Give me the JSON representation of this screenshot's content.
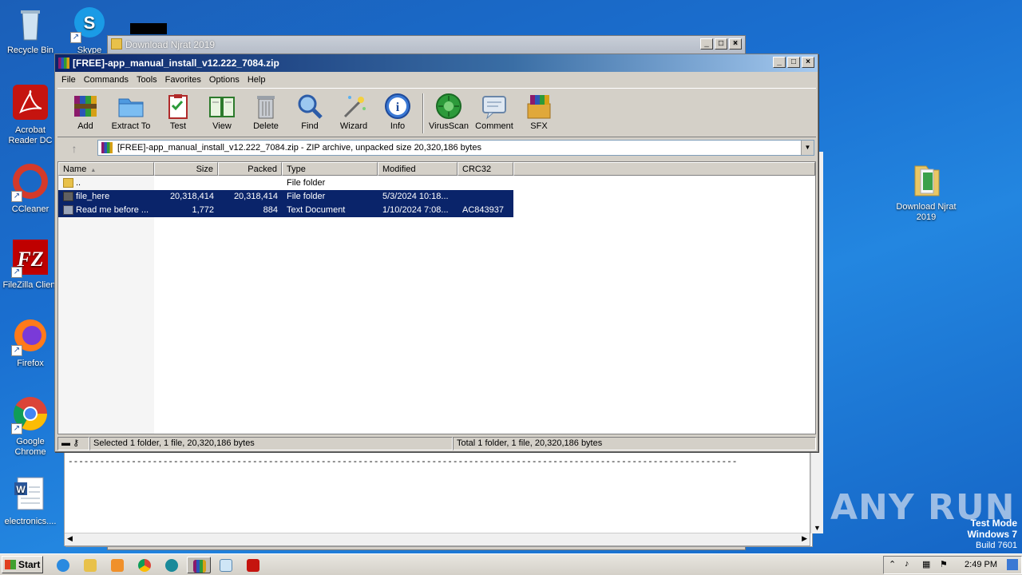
{
  "desktop": {
    "icons_left": [
      {
        "label": "Recycle Bin"
      },
      {
        "label": "Skype"
      },
      {
        "label": "Acrobat Reader DC"
      },
      {
        "label": "CCleaner"
      },
      {
        "label": "FileZilla Client"
      },
      {
        "label": "Firefox"
      },
      {
        "label": "Google Chrome"
      },
      {
        "label": "electronics...."
      }
    ],
    "icon_right": {
      "label": "Download Njrat 2019"
    }
  },
  "bg_window": {
    "title": "Download Njrat 2019",
    "dashes": "-------------------------------------------------------------------------------------------------------------------------------"
  },
  "winrar": {
    "title": "[FREE]-app_manual_install_v12.222_7084.zip",
    "menu": [
      "File",
      "Commands",
      "Tools",
      "Favorites",
      "Options",
      "Help"
    ],
    "toolbar": [
      {
        "label": "Add",
        "icon": "add-archive-icon"
      },
      {
        "label": "Extract To",
        "icon": "extract-folder-icon"
      },
      {
        "label": "Test",
        "icon": "test-clipboard-icon"
      },
      {
        "label": "View",
        "icon": "view-book-icon"
      },
      {
        "label": "Delete",
        "icon": "trash-icon"
      },
      {
        "label": "Find",
        "icon": "magnifier-icon"
      },
      {
        "label": "Wizard",
        "icon": "wand-icon"
      },
      {
        "label": "Info",
        "icon": "info-icon"
      },
      {
        "label": "VirusScan",
        "icon": "virus-scan-icon"
      },
      {
        "label": "Comment",
        "icon": "comment-icon"
      },
      {
        "label": "SFX",
        "icon": "sfx-box-icon"
      }
    ],
    "address": "[FREE]-app_manual_install_v12.222_7084.zip - ZIP archive, unpacked size 20,320,186 bytes",
    "columns": {
      "name": "Name",
      "size": "Size",
      "packed": "Packed",
      "type": "Type",
      "modified": "Modified",
      "crc": "CRC32"
    },
    "rows": [
      {
        "name": "..",
        "size": "",
        "packed": "",
        "type": "File folder",
        "modified": "",
        "crc": "",
        "selected": false
      },
      {
        "name": "file_here",
        "size": "20,318,414",
        "packed": "20,318,414",
        "type": "File folder",
        "modified": "5/3/2024 10:18...",
        "crc": "",
        "selected": true
      },
      {
        "name": "Read me before ...",
        "size": "1,772",
        "packed": "884",
        "type": "Text Document",
        "modified": "1/10/2024 7:08...",
        "crc": "AC843937",
        "selected": true
      }
    ],
    "status_left": "Selected 1 folder, 1 file, 20,320,186 bytes",
    "status_right": "Total 1 folder, 1 file, 20,320,186 bytes"
  },
  "watermark": {
    "text": "ANY RUN"
  },
  "system": {
    "line1": "Test Mode",
    "line2": "Windows 7",
    "line3": "Build 7601"
  },
  "taskbar": {
    "start_label": "Start",
    "clock": "2:49 PM"
  },
  "colors": {
    "selection": "#0a246a",
    "desktop": "#1a6fd0",
    "title_active": "#0a246a"
  }
}
